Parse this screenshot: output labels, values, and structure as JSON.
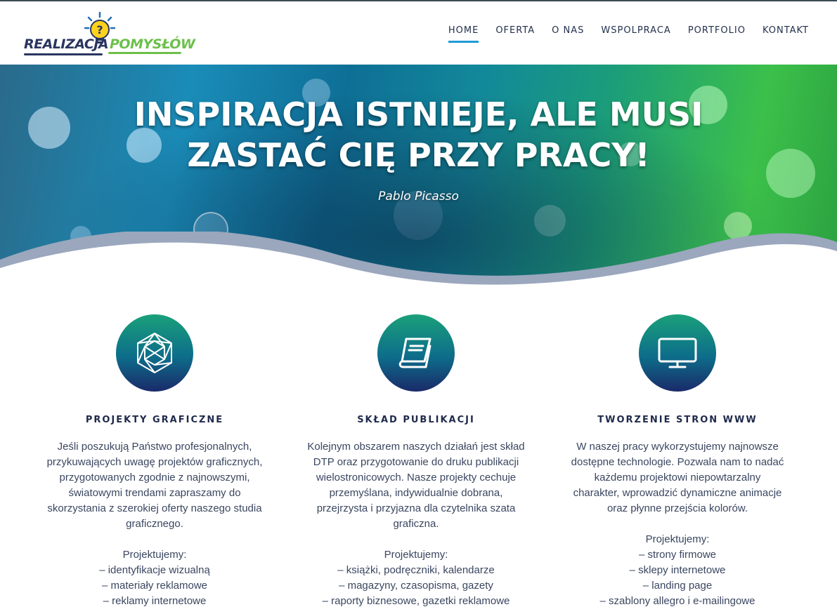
{
  "logo": {
    "part1": "REALIZACJA",
    "part2": "POMYSŁÓW"
  },
  "nav": {
    "items": [
      "HOME",
      "OFERTA",
      "O NAS",
      "WSPOLPRACA",
      "PORTFOLIO",
      "KONTAKT"
    ],
    "active": "HOME"
  },
  "hero": {
    "title_line1": "INSPIRACJA ISTNIEJE, ALE MUSI",
    "title_line2": "ZASTAĆ CIĘ PRZY PRACY!",
    "author": "Pablo Picasso"
  },
  "features": [
    {
      "icon": "geometric-polyhedron-icon",
      "title": "PROJEKTY GRAFICZNE",
      "desc": [
        "Jeśli poszukują Państwo profesjonalnych,",
        "przykuwających uwagę projektów graficznych,",
        "przygotowanych zgodnie z najnowszymi,",
        "światowymi trendami zapraszamy do",
        "skorzystania z szerokiej oferty naszego studia",
        "graficznego."
      ],
      "list_heading": "Projektujemy:",
      "list": [
        "– identyfikacje wizualną",
        "– materiały reklamowe",
        "– reklamy internetowe"
      ]
    },
    {
      "icon": "book-icon",
      "title": "SKŁAD PUBLIKACJI",
      "desc": [
        "Kolejnym obszarem naszych działań jest skład",
        "DTP oraz przygotowanie do druku publikacji",
        "wielostronicowych. Nasze projekty cechuje",
        "przemyślana, indywidualnie dobrana,",
        "przejrzysta i przyjazna dla czytelnika szata",
        "graficzna."
      ],
      "list_heading": "Projektujemy:",
      "list": [
        "– książki, podręczniki, kalendarze",
        "– magazyny, czasopisma, gazety",
        "– raporty biznesowe, gazetki reklamowe"
      ]
    },
    {
      "icon": "monitor-icon",
      "title": "TWORZENIE STRON WWW",
      "desc": [
        "W naszej pracy wykorzystujemy najnowsze",
        "dostępne technologie. Pozwala nam to nadać",
        "każdemu projektowi niepowtarzalny",
        "charakter, wprowadzić dynamiczne animacje",
        "oraz płynne przejścia kolorów."
      ],
      "list_heading": "Projektujemy:",
      "list": [
        "– strony firmowe",
        "– sklepy internetowe",
        "– landing page",
        "– szablony allegro i e-mailingowe"
      ]
    }
  ]
}
